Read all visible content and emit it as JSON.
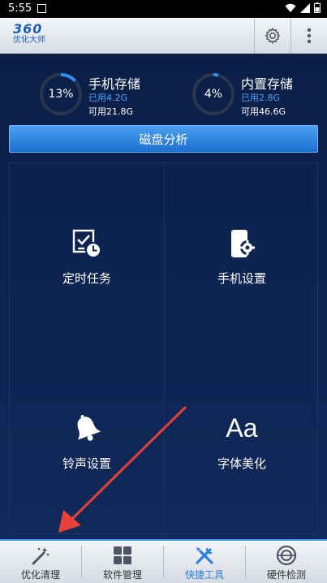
{
  "status": {
    "time": "5:55"
  },
  "app": {
    "logo_number": "360",
    "logo_text": "优化大师"
  },
  "storage": [
    {
      "percent": 13,
      "percent_label": "13%",
      "title": "手机存储",
      "used": "已用4.2G",
      "available": "可用21.8G"
    },
    {
      "percent": 4,
      "percent_label": "4%",
      "title": "内置存储",
      "used": "已用2.8G",
      "available": "可用46.6G"
    }
  ],
  "analyze_button": "磁盘分析",
  "tools": [
    {
      "label": "定时任务",
      "icon": "timed-task-icon"
    },
    {
      "label": "手机设置",
      "icon": "phone-settings-icon"
    },
    {
      "label": "铃声设置",
      "icon": "bell-icon"
    },
    {
      "label": "字体美化",
      "icon": "font-icon",
      "glyph": "Aa"
    }
  ],
  "tabs": [
    {
      "label": "优化清理",
      "icon": "magic-wand-icon",
      "active": false
    },
    {
      "label": "软件管理",
      "icon": "apps-grid-icon",
      "active": false
    },
    {
      "label": "快捷工具",
      "icon": "tools-icon",
      "active": true
    },
    {
      "label": "硬件检测",
      "icon": "hardware-check-icon",
      "active": false
    }
  ],
  "colors": {
    "accent": "#2b7fe0",
    "background": "#0b1b3d",
    "ring_track": "#2a3550",
    "annotation_arrow": "#e8413a"
  }
}
